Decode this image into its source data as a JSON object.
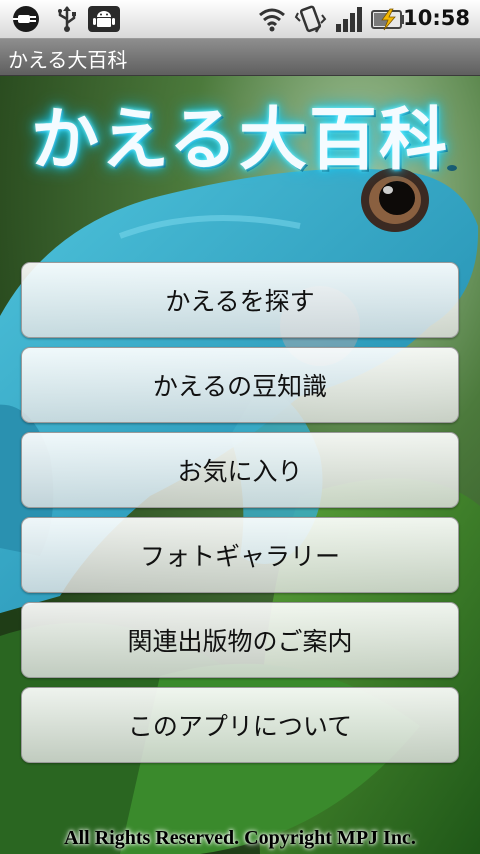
{
  "status_bar": {
    "time": "10:58",
    "icons": [
      "usb-plug-icon",
      "usb-icon",
      "android-debug-icon",
      "wifi-icon",
      "vibrate-icon",
      "signal-icon",
      "battery-charging-icon"
    ]
  },
  "app": {
    "title": "かえる大百科",
    "hero_title": "かえる大百科"
  },
  "menu": [
    {
      "label": "かえるを探す"
    },
    {
      "label": "かえるの豆知識"
    },
    {
      "label": "お気に入り"
    },
    {
      "label": "フォトギャラリー"
    },
    {
      "label": "関連出版物のご案内"
    },
    {
      "label": "このアプリについて"
    }
  ],
  "footer": {
    "copyright": "All Rights Reserved. Copyright MPJ Inc."
  },
  "colors": {
    "hero_glow": "#22d9ff",
    "frog": "#3fb6d0",
    "leaf": "#2f7d2a"
  }
}
